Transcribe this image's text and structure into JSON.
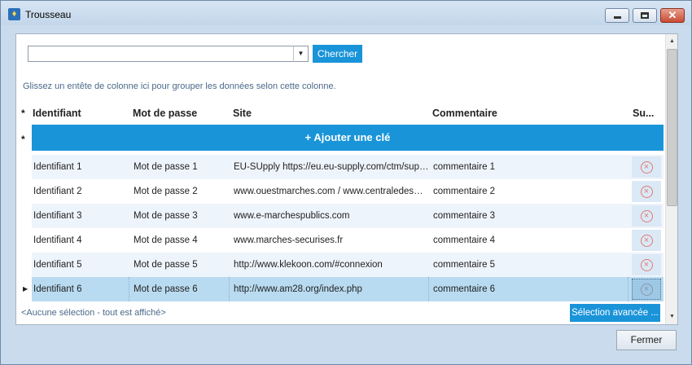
{
  "window": {
    "title": "Trousseau",
    "app_icon": "trophy-icon",
    "controls": {
      "minimize": "minimize-icon",
      "maximize": "maximize-icon",
      "close": "close-icon"
    }
  },
  "search": {
    "value": "",
    "button_label": "Chercher"
  },
  "grid": {
    "group_hint": "Glissez un entête de colonne ici pour grouper les données selon cette colonne.",
    "columns": [
      "Identifiant",
      "Mot de passe",
      "Site",
      "Commentaire",
      "Su..."
    ],
    "new_row_marker": "*",
    "add_button_label": "+ Ajouter une clé",
    "selected_row_index": 5,
    "rows": [
      {
        "id": "Identifiant 1",
        "password": "Mot de passe 1",
        "site": "EU-SUpply https://eu.eu-supply.com/ctm/supplier",
        "comment": "commentaire 1"
      },
      {
        "id": "Identifiant 2",
        "password": "Mot de passe 2",
        "site": "www.ouestmarches.com / www.centraledesmarches.com",
        "comment": "commentaire 2"
      },
      {
        "id": "Identifiant 3",
        "password": "Mot de passe 3",
        "site": "www.e-marchespublics.com",
        "comment": "commentaire 3"
      },
      {
        "id": "Identifiant 4",
        "password": "Mot de passe 4",
        "site": "www.marches-securises.fr",
        "comment": "commentaire 4"
      },
      {
        "id": "Identifiant 5",
        "password": "Mot de passe 5",
        "site": "http://www.klekoon.com/#connexion",
        "comment": "commentaire 5"
      },
      {
        "id": "Identifiant 6",
        "password": "Mot de passe 6",
        "site": "http://www.am28.org/index.php",
        "comment": "commentaire 6"
      }
    ],
    "delete_icon": "delete-circle-x-icon"
  },
  "footer": {
    "selection_status": "<Aucune sélection - tout est affiché>",
    "advanced_button_label": "Sélection avancée ..."
  },
  "dialog": {
    "close_button_label": "Fermer"
  },
  "colors": {
    "accent": "#1a94d9",
    "selected_row": "#b9dbf1",
    "alt_row": "#eef4fb",
    "delete_icon": "#e07a72"
  }
}
